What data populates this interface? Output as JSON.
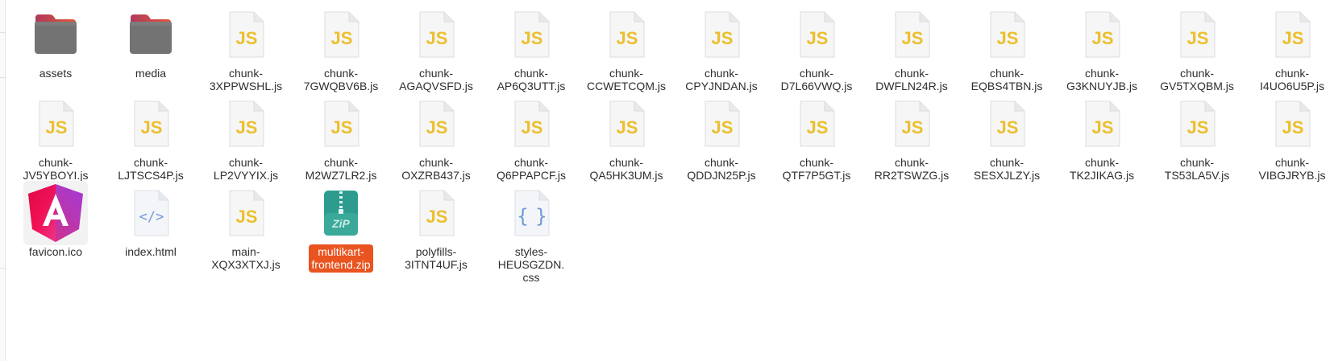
{
  "window": {
    "accent_color": "#e95420"
  },
  "files": [
    {
      "name": "assets",
      "icon": "folder-icon",
      "selected": false
    },
    {
      "name": "media",
      "icon": "folder-icon",
      "selected": false
    },
    {
      "name": "chunk-\n3XPPWSHL.js",
      "icon": "javascript-file-icon",
      "selected": false
    },
    {
      "name": "chunk-\n7GWQBV6B.js",
      "icon": "javascript-file-icon",
      "selected": false
    },
    {
      "name": "chunk-\nAGAQVSFD.js",
      "icon": "javascript-file-icon",
      "selected": false
    },
    {
      "name": "chunk-\nAP6Q3UTT.js",
      "icon": "javascript-file-icon",
      "selected": false
    },
    {
      "name": "chunk-\nCCWETCQM.js",
      "icon": "javascript-file-icon",
      "selected": false
    },
    {
      "name": "chunk-\nCPYJNDAN.js",
      "icon": "javascript-file-icon",
      "selected": false
    },
    {
      "name": "chunk-\nD7L66VWQ.js",
      "icon": "javascript-file-icon",
      "selected": false
    },
    {
      "name": "chunk-\nDWFLN24R.js",
      "icon": "javascript-file-icon",
      "selected": false
    },
    {
      "name": "chunk-\nEQBS4TBN.js",
      "icon": "javascript-file-icon",
      "selected": false
    },
    {
      "name": "chunk-\nG3KNUYJB.js",
      "icon": "javascript-file-icon",
      "selected": false
    },
    {
      "name": "chunk-\nGV5TXQBM.js",
      "icon": "javascript-file-icon",
      "selected": false
    },
    {
      "name": "chunk-\nI4UO6U5P.js",
      "icon": "javascript-file-icon",
      "selected": false
    },
    {
      "name": "chunk-\nJV5YBOYI.js",
      "icon": "javascript-file-icon",
      "selected": false
    },
    {
      "name": "chunk-\nLJTSCS4P.js",
      "icon": "javascript-file-icon",
      "selected": false
    },
    {
      "name": "chunk-\nLP2VYYIX.js",
      "icon": "javascript-file-icon",
      "selected": false
    },
    {
      "name": "chunk-\nM2WZ7LR2.js",
      "icon": "javascript-file-icon",
      "selected": false
    },
    {
      "name": "chunk-\nOXZRB437.js",
      "icon": "javascript-file-icon",
      "selected": false
    },
    {
      "name": "chunk-\nQ6PPAPCF.js",
      "icon": "javascript-file-icon",
      "selected": false
    },
    {
      "name": "chunk-\nQA5HK3UM.js",
      "icon": "javascript-file-icon",
      "selected": false
    },
    {
      "name": "chunk-\nQDDJN25P.js",
      "icon": "javascript-file-icon",
      "selected": false
    },
    {
      "name": "chunk-\nQTF7P5GT.js",
      "icon": "javascript-file-icon",
      "selected": false
    },
    {
      "name": "chunk-\nRR2TSWZG.js",
      "icon": "javascript-file-icon",
      "selected": false
    },
    {
      "name": "chunk-\nSESXJLZY.js",
      "icon": "javascript-file-icon",
      "selected": false
    },
    {
      "name": "chunk-\nTK2JIKAG.js",
      "icon": "javascript-file-icon",
      "selected": false
    },
    {
      "name": "chunk-\nTS53LA5V.js",
      "icon": "javascript-file-icon",
      "selected": false
    },
    {
      "name": "chunk-\nVIBGJRYB.js",
      "icon": "javascript-file-icon",
      "selected": false
    },
    {
      "name": "favicon.ico",
      "icon": "angular-logo-icon",
      "selected": false
    },
    {
      "name": "index.html",
      "icon": "html-file-icon",
      "selected": false
    },
    {
      "name": "main-\nXQX3XTXJ.js",
      "icon": "javascript-file-icon",
      "selected": false
    },
    {
      "name": "multikart-\nfrontend.zip",
      "icon": "zip-archive-icon",
      "selected": true
    },
    {
      "name": "polyfills-\n3ITNT4UF.js",
      "icon": "javascript-file-icon",
      "selected": false
    },
    {
      "name": "styles-\nHEUSGZDN.\ncss",
      "icon": "css-file-icon",
      "selected": false
    }
  ],
  "icon_text": {
    "js": "JS",
    "html": "</>",
    "css": "{ }",
    "zip": "ZiP"
  }
}
